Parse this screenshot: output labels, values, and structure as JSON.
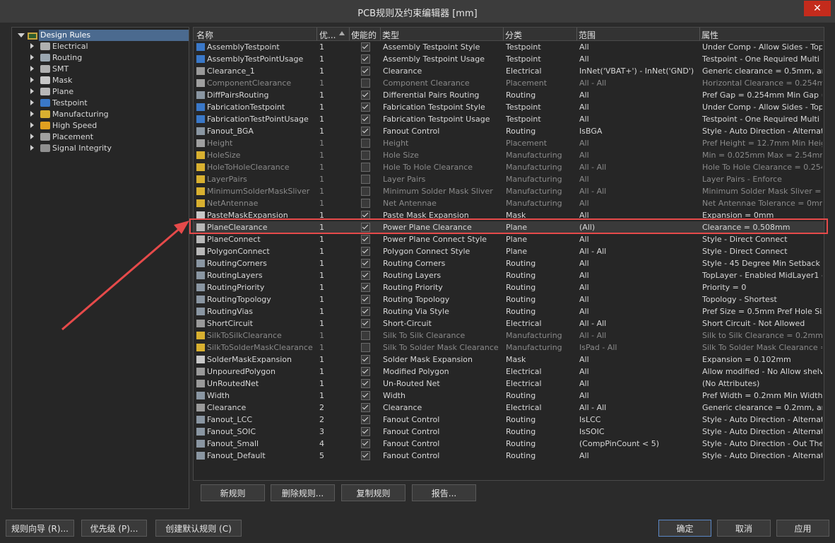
{
  "window": {
    "title": "PCB规则及约束编辑器 [mm]",
    "close_glyph": "✕"
  },
  "tree": {
    "root": "Design Rules",
    "items": [
      {
        "label": "Electrical",
        "icon": "electrical-icon"
      },
      {
        "label": "Routing",
        "icon": "routing-icon"
      },
      {
        "label": "SMT",
        "icon": "smt-icon"
      },
      {
        "label": "Mask",
        "icon": "mask-icon"
      },
      {
        "label": "Plane",
        "icon": "plane-icon"
      },
      {
        "label": "Testpoint",
        "icon": "testpoint-icon"
      },
      {
        "label": "Manufacturing",
        "icon": "manufacturing-icon"
      },
      {
        "label": "High Speed",
        "icon": "high-speed-icon"
      },
      {
        "label": "Placement",
        "icon": "placement-icon"
      },
      {
        "label": "Signal Integrity",
        "icon": "signal-integrity-icon"
      }
    ]
  },
  "grid": {
    "columns": [
      "名称",
      "优...",
      "使能的",
      "类型",
      "分类",
      "范围",
      "属性"
    ],
    "rows": [
      {
        "name": "AssemblyTestpoint",
        "priority": "1",
        "enabled": true,
        "type": "Assembly Testpoint Style",
        "category": "Testpoint",
        "scope": "All",
        "attrs": "Under Comp - Allow     Sides - Top"
      },
      {
        "name": "AssemblyTestPointUsage",
        "priority": "1",
        "enabled": true,
        "type": "Assembly Testpoint Usage",
        "category": "Testpoint",
        "scope": "All",
        "attrs": "Testpoint - One Required   Multi"
      },
      {
        "name": "Clearance_1",
        "priority": "1",
        "enabled": true,
        "type": "Clearance",
        "category": "Electrical",
        "scope": "InNet('VBAT+')   -   InNet('GND')",
        "attrs": "Generic clearance = 0.5mm, and 9"
      },
      {
        "name": "ComponentClearance",
        "priority": "1",
        "enabled": false,
        "type": "Component Clearance",
        "category": "Placement",
        "scope": "All   -   All",
        "attrs": "Horizontal Clearance = 0.254mm"
      },
      {
        "name": "DiffPairsRouting",
        "priority": "1",
        "enabled": true,
        "type": "Differential Pairs Routing",
        "category": "Routing",
        "scope": "All",
        "attrs": "Pref Gap = 0.254mm    Min Gap ="
      },
      {
        "name": "FabricationTestpoint",
        "priority": "1",
        "enabled": true,
        "type": "Fabrication Testpoint Style",
        "category": "Testpoint",
        "scope": "All",
        "attrs": "Under Comp - Allow     Sides - Top"
      },
      {
        "name": "FabricationTestPointUsage",
        "priority": "1",
        "enabled": true,
        "type": "Fabrication Testpoint Usage",
        "category": "Testpoint",
        "scope": "All",
        "attrs": "Testpoint - One Required   Multi"
      },
      {
        "name": "Fanout_BGA",
        "priority": "1",
        "enabled": true,
        "type": "Fanout Control",
        "category": "Routing",
        "scope": "IsBGA",
        "attrs": "Style - Auto     Direction - Alternat"
      },
      {
        "name": "Height",
        "priority": "1",
        "enabled": false,
        "type": "Height",
        "category": "Placement",
        "scope": "All",
        "attrs": "Pref Height = 12.7mm    Min Heig"
      },
      {
        "name": "HoleSize",
        "priority": "1",
        "enabled": false,
        "type": "Hole Size",
        "category": "Manufacturing",
        "scope": "All",
        "attrs": "Min = 0.025mm     Max = 2.54mm"
      },
      {
        "name": "HoleToHoleClearance",
        "priority": "1",
        "enabled": false,
        "type": "Hole To Hole Clearance",
        "category": "Manufacturing",
        "scope": "All   -   All",
        "attrs": "Hole To Hole Clearance = 0.254m"
      },
      {
        "name": "LayerPairs",
        "priority": "1",
        "enabled": false,
        "type": "Layer Pairs",
        "category": "Manufacturing",
        "scope": "All",
        "attrs": "Layer Pairs - Enforce"
      },
      {
        "name": "MinimumSolderMaskSliver",
        "priority": "1",
        "enabled": false,
        "type": "Minimum Solder Mask Sliver",
        "category": "Manufacturing",
        "scope": "All   -   All",
        "attrs": "Minimum Solder Mask Sliver = 0.2"
      },
      {
        "name": "NetAntennae",
        "priority": "1",
        "enabled": false,
        "type": "Net Antennae",
        "category": "Manufacturing",
        "scope": "All",
        "attrs": "Net Antennae Tolerance = 0mm"
      },
      {
        "name": "PasteMaskExpansion",
        "priority": "1",
        "enabled": true,
        "type": "Paste Mask Expansion",
        "category": "Mask",
        "scope": "All",
        "attrs": "Expansion = 0mm"
      },
      {
        "name": "PlaneClearance",
        "priority": "1",
        "enabled": true,
        "type": "Power Plane Clearance",
        "category": "Plane",
        "scope": "(All)",
        "attrs": "Clearance = 0.508mm",
        "selected": true
      },
      {
        "name": "PlaneConnect",
        "priority": "1",
        "enabled": true,
        "type": "Power Plane Connect Style",
        "category": "Plane",
        "scope": "All",
        "attrs": "Style - Direct Connect"
      },
      {
        "name": "PolygonConnect",
        "priority": "1",
        "enabled": true,
        "type": "Polygon Connect Style",
        "category": "Plane",
        "scope": "All   -   All",
        "attrs": "Style - Direct Connect"
      },
      {
        "name": "RoutingCorners",
        "priority": "1",
        "enabled": true,
        "type": "Routing Corners",
        "category": "Routing",
        "scope": "All",
        "attrs": "Style - 45 Degree     Min Setback ="
      },
      {
        "name": "RoutingLayers",
        "priority": "1",
        "enabled": true,
        "type": "Routing Layers",
        "category": "Routing",
        "scope": "All",
        "attrs": "TopLayer - Enabled MidLayer1 - E"
      },
      {
        "name": "RoutingPriority",
        "priority": "1",
        "enabled": true,
        "type": "Routing Priority",
        "category": "Routing",
        "scope": "All",
        "attrs": "Priority = 0"
      },
      {
        "name": "RoutingTopology",
        "priority": "1",
        "enabled": true,
        "type": "Routing Topology",
        "category": "Routing",
        "scope": "All",
        "attrs": "Topology - Shortest"
      },
      {
        "name": "RoutingVias",
        "priority": "1",
        "enabled": true,
        "type": "Routing Via Style",
        "category": "Routing",
        "scope": "All",
        "attrs": "Pref Size = 0.5mm    Pref Hole Size"
      },
      {
        "name": "ShortCircuit",
        "priority": "1",
        "enabled": true,
        "type": "Short-Circuit",
        "category": "Electrical",
        "scope": "All   -   All",
        "attrs": "Short Circuit - Not Allowed"
      },
      {
        "name": "SilkToSilkClearance",
        "priority": "1",
        "enabled": false,
        "type": "Silk To Silk Clearance",
        "category": "Manufacturing",
        "scope": "All   -   All",
        "attrs": "Silk to Silk Clearance = 0.2mm"
      },
      {
        "name": "SilkToSolderMaskClearance",
        "priority": "1",
        "enabled": false,
        "type": "Silk To Solder Mask Clearance",
        "category": "Manufacturing",
        "scope": "IsPad   -   All",
        "attrs": "Silk To Solder Mask Clearance = 0"
      },
      {
        "name": "SolderMaskExpansion",
        "priority": "1",
        "enabled": true,
        "type": "Solder Mask Expansion",
        "category": "Mask",
        "scope": "All",
        "attrs": "Expansion = 0.102mm"
      },
      {
        "name": "UnpouredPolygon",
        "priority": "1",
        "enabled": true,
        "type": "Modified Polygon",
        "category": "Electrical",
        "scope": "All",
        "attrs": "Allow modified - No   Allow shelve"
      },
      {
        "name": "UnRoutedNet",
        "priority": "1",
        "enabled": true,
        "type": "Un-Routed Net",
        "category": "Electrical",
        "scope": "All",
        "attrs": "(No Attributes)"
      },
      {
        "name": "Width",
        "priority": "1",
        "enabled": true,
        "type": "Width",
        "category": "Routing",
        "scope": "All",
        "attrs": "Pref Width = 0.2mm    Min Width ="
      },
      {
        "name": "Clearance",
        "priority": "2",
        "enabled": true,
        "type": "Clearance",
        "category": "Electrical",
        "scope": "All   -   All",
        "attrs": "Generic clearance = 0.2mm, and 9"
      },
      {
        "name": "Fanout_LCC",
        "priority": "2",
        "enabled": true,
        "type": "Fanout Control",
        "category": "Routing",
        "scope": "IsLCC",
        "attrs": "Style - Auto     Direction - Alternat"
      },
      {
        "name": "Fanout_SOIC",
        "priority": "3",
        "enabled": true,
        "type": "Fanout Control",
        "category": "Routing",
        "scope": "IsSOIC",
        "attrs": "Style - Auto     Direction - Alternat"
      },
      {
        "name": "Fanout_Small",
        "priority": "4",
        "enabled": true,
        "type": "Fanout Control",
        "category": "Routing",
        "scope": "(CompPinCount < 5)",
        "attrs": "Style - Auto     Direction - Out The"
      },
      {
        "name": "Fanout_Default",
        "priority": "5",
        "enabled": true,
        "type": "Fanout Control",
        "category": "Routing",
        "scope": "All",
        "attrs": "Style - Auto     Direction - Alternat"
      }
    ]
  },
  "grid_buttons": {
    "new": "新规则",
    "delete": "删除规则...",
    "copy": "复制规则",
    "report": "报告..."
  },
  "footer": {
    "wizard": "规则向导 (R)...",
    "priority": "优先级 (P)...",
    "create_defaults": "创建默认规则 (C)",
    "ok": "确定",
    "cancel": "取消",
    "apply": "应用"
  },
  "colors": {
    "accent": "#4b6a8f",
    "highlight": "#e64a4a",
    "ok_border": "#5b87c5"
  }
}
